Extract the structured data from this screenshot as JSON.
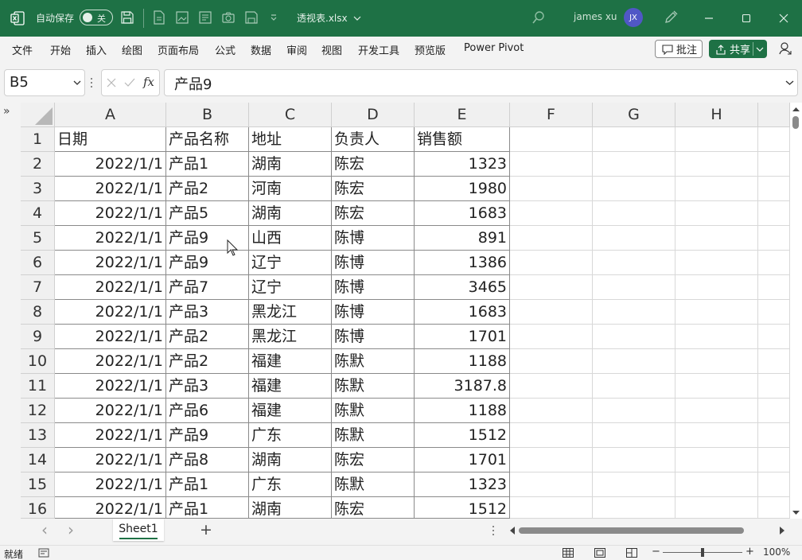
{
  "titlebar": {
    "autosave_label": "自动保存",
    "autosave_state": "关",
    "filename": "透视表.xlsx",
    "user_name": "james xu",
    "user_initials": "JX"
  },
  "ribbon": {
    "tabs": [
      "文件",
      "开始",
      "插入",
      "绘图",
      "页面布局",
      "公式",
      "数据",
      "审阅",
      "视图",
      "开发工具",
      "预览版",
      "Power Pivot"
    ],
    "comment_label": "批注",
    "share_label": "共享"
  },
  "formula_bar": {
    "name_box": "B5",
    "fx_label": "fx",
    "content": "产品9"
  },
  "collapse_glyph": "»",
  "grid": {
    "columns": [
      "A",
      "B",
      "C",
      "D",
      "E",
      "F",
      "G",
      "H"
    ],
    "row_numbers": [
      "1",
      "2",
      "3",
      "4",
      "5",
      "6",
      "7",
      "8",
      "9",
      "10",
      "11",
      "12",
      "13",
      "14",
      "15",
      "16"
    ],
    "rows": [
      [
        "日期",
        "产品名称",
        "地址",
        "负责人",
        "销售额"
      ],
      [
        "2022/1/1",
        "产品1",
        "湖南",
        "陈宏",
        "1323"
      ],
      [
        "2022/1/1",
        "产品2",
        "河南",
        "陈宏",
        "1980"
      ],
      [
        "2022/1/1",
        "产品5",
        "湖南",
        "陈宏",
        "1683"
      ],
      [
        "2022/1/1",
        "产品9",
        "山西",
        "陈博",
        "891"
      ],
      [
        "2022/1/1",
        "产品9",
        "辽宁",
        "陈博",
        "1386"
      ],
      [
        "2022/1/1",
        "产品7",
        "辽宁",
        "陈博",
        "3465"
      ],
      [
        "2022/1/1",
        "产品3",
        "黑龙江",
        "陈博",
        "1683"
      ],
      [
        "2022/1/1",
        "产品2",
        "黑龙江",
        "陈博",
        "1701"
      ],
      [
        "2022/1/1",
        "产品2",
        "福建",
        "陈默",
        "1188"
      ],
      [
        "2022/1/1",
        "产品3",
        "福建",
        "陈默",
        "3187.8"
      ],
      [
        "2022/1/1",
        "产品6",
        "福建",
        "陈默",
        "1188"
      ],
      [
        "2022/1/1",
        "产品9",
        "广东",
        "陈默",
        "1512"
      ],
      [
        "2022/1/1",
        "产品8",
        "湖南",
        "陈宏",
        "1701"
      ],
      [
        "2022/1/1",
        "产品1",
        "广东",
        "陈默",
        "1323"
      ],
      [
        "2022/1/1",
        "产品1",
        "湖南",
        "陈宏",
        "1512"
      ]
    ]
  },
  "sheets": {
    "active": "Sheet1",
    "add_glyph": "+",
    "prev_glyph": "‹",
    "next_glyph": "›"
  },
  "statusbar": {
    "status": "就绪",
    "zoom_minus": "−",
    "zoom_plus": "+",
    "zoom_level": "100%"
  },
  "colors": {
    "brand": "#1e7145",
    "avatar": "#5057c6"
  }
}
